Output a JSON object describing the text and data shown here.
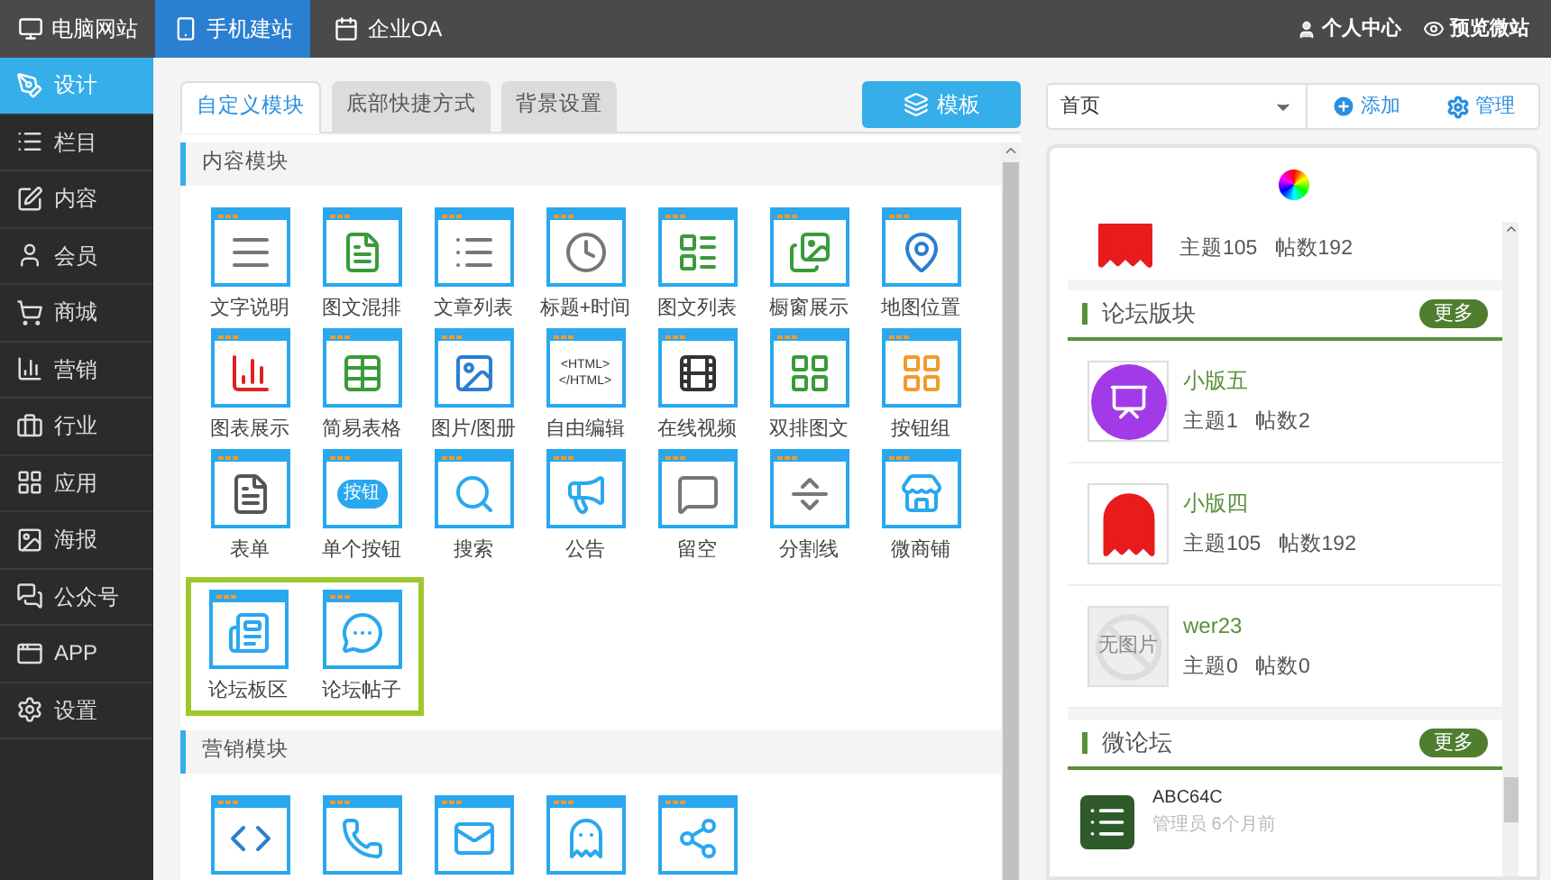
{
  "top_nav": {
    "tabs": [
      {
        "label": "电脑网站",
        "selected": false
      },
      {
        "label": "手机建站",
        "selected": true
      },
      {
        "label": "企业OA",
        "selected": false
      }
    ],
    "links": [
      "个人中心",
      "预览微站"
    ]
  },
  "sidebar": {
    "items": [
      {
        "label": "设计",
        "selected": true
      },
      {
        "label": "栏目",
        "selected": false
      },
      {
        "label": "内容",
        "selected": false
      },
      {
        "label": "会员",
        "selected": false
      },
      {
        "label": "商城",
        "selected": false
      },
      {
        "label": "营销",
        "selected": false
      },
      {
        "label": "行业",
        "selected": false
      },
      {
        "label": "应用",
        "selected": false
      },
      {
        "label": "海报",
        "selected": false
      },
      {
        "label": "公众号",
        "selected": false
      },
      {
        "label": "APP",
        "selected": false
      },
      {
        "label": "设置",
        "selected": false
      }
    ]
  },
  "editor": {
    "tabs": [
      {
        "label": "自定义模块",
        "selected": true
      },
      {
        "label": "底部快捷方式",
        "selected": false
      },
      {
        "label": "背景设置",
        "selected": false
      }
    ],
    "template_button": "模板",
    "sections": [
      {
        "title": "内容模块",
        "items": [
          {
            "kind": "text",
            "label": "文字说明"
          },
          {
            "kind": "image-text",
            "label": "图文混排"
          },
          {
            "kind": "article-list",
            "label": "文章列表"
          },
          {
            "kind": "title-time",
            "label": "标题+时间"
          },
          {
            "kind": "image-list",
            "label": "图文列表"
          },
          {
            "kind": "gallery",
            "label": "橱窗展示"
          },
          {
            "kind": "map",
            "label": "地图位置"
          },
          {
            "kind": "chart",
            "label": "图表展示"
          },
          {
            "kind": "table",
            "label": "简易表格"
          },
          {
            "kind": "album",
            "label": "图片/图册"
          },
          {
            "kind": "html",
            "label": "自由编辑",
            "icon_text": "<HTML> </HTML>"
          },
          {
            "kind": "video",
            "label": "在线视频"
          },
          {
            "kind": "double",
            "label": "双排图文"
          },
          {
            "kind": "button-group",
            "label": "按钮组"
          },
          {
            "kind": "form",
            "label": "表单"
          },
          {
            "kind": "button",
            "label": "单个按钮",
            "icon_text": "按钮"
          },
          {
            "kind": "search",
            "label": "搜索"
          },
          {
            "kind": "notice",
            "label": "公告"
          },
          {
            "kind": "message",
            "label": "留空"
          },
          {
            "kind": "divider",
            "label": "分割线"
          },
          {
            "kind": "shop",
            "label": "微商铺"
          }
        ],
        "highlighted_items": [
          {
            "kind": "forum-board",
            "label": "论坛板区"
          },
          {
            "kind": "forum-post",
            "label": "论坛帖子"
          }
        ]
      },
      {
        "title": "营销模块",
        "items": [
          {
            "kind": "image-code"
          },
          {
            "kind": "phone"
          },
          {
            "kind": "mail"
          },
          {
            "kind": "qq"
          },
          {
            "kind": "share"
          }
        ]
      }
    ]
  },
  "preview": {
    "page_select": "首页",
    "add_button": "添加",
    "manage_button": "管理",
    "top_item": {
      "stats": [
        "主题105",
        "帖数192"
      ]
    },
    "forum_board": {
      "title": "论坛版块",
      "more": "更多",
      "items": [
        {
          "kind": "presenter",
          "name": "小版五",
          "stats": [
            "主题1",
            "帖数2"
          ]
        },
        {
          "kind": "penguin",
          "name": "小版四",
          "stats": [
            "主题105",
            "帖数192"
          ]
        },
        {
          "kind": "none",
          "image_text": "无图片",
          "name": "wer23",
          "stats": [
            "主题0",
            "帖数0"
          ]
        }
      ]
    },
    "micro_forum": {
      "title": "微论坛",
      "more": "更多",
      "post": {
        "author": "ABC64C",
        "meta": "管理员 6个月前"
      }
    }
  }
}
